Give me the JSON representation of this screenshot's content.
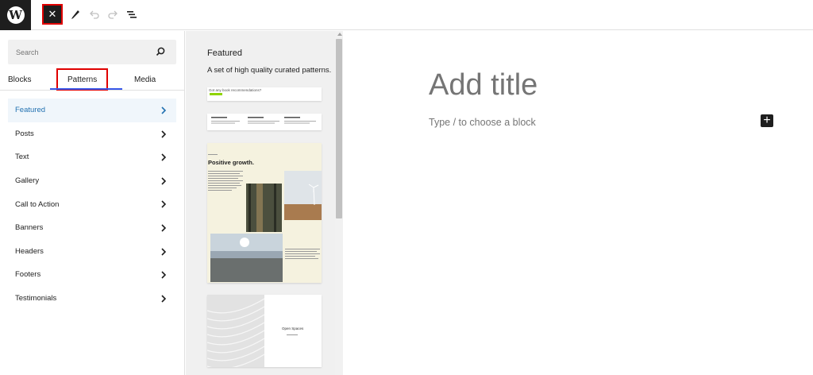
{
  "topbar": {
    "logo_letter": "W",
    "close_glyph": "✕",
    "tools": [
      "pencil-icon",
      "undo-icon",
      "redo-icon",
      "list-view-icon"
    ]
  },
  "sidebar": {
    "search_placeholder": "Search",
    "tabs": [
      {
        "label": "Blocks"
      },
      {
        "label": "Patterns"
      },
      {
        "label": "Media"
      }
    ],
    "categories": [
      {
        "label": "Featured"
      },
      {
        "label": "Posts"
      },
      {
        "label": "Text"
      },
      {
        "label": "Gallery"
      },
      {
        "label": "Call to Action"
      },
      {
        "label": "Banners"
      },
      {
        "label": "Headers"
      },
      {
        "label": "Footers"
      },
      {
        "label": "Testimonials"
      }
    ]
  },
  "patterns_panel": {
    "title": "Featured",
    "description": "A set of high quality curated patterns.",
    "card1_text": "Got any book recommendations?",
    "card3_heading": "Positive growth.",
    "card4_text": "Open Spaces"
  },
  "editor": {
    "title_placeholder": "Add title",
    "block_placeholder": "Type / to choose a block",
    "add_glyph": "+"
  },
  "colors": {
    "accent": "#3858e9",
    "highlight_box": "#e00000",
    "active_category_text": "#2271b1",
    "card_cream": "#f5f2df"
  }
}
